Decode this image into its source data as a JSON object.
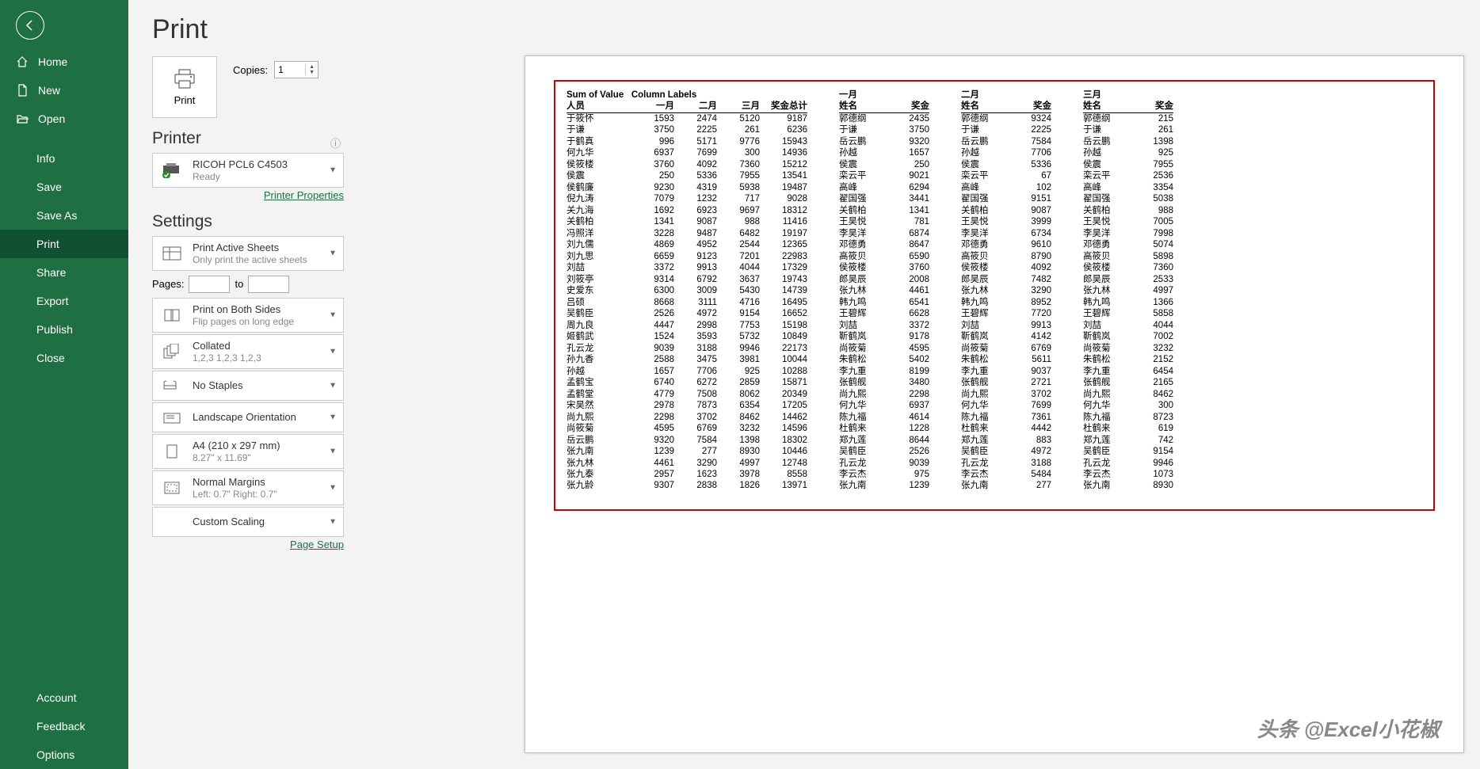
{
  "sidebar": {
    "back": "←",
    "items": [
      {
        "icon": "home",
        "label": "Home"
      },
      {
        "icon": "new",
        "label": "New"
      },
      {
        "icon": "open",
        "label": "Open"
      }
    ],
    "subitems": [
      "Info",
      "Save",
      "Save As",
      "Print",
      "Share",
      "Export",
      "Publish",
      "Close"
    ],
    "active": "Print",
    "footer": [
      "Account",
      "Feedback",
      "Options"
    ]
  },
  "page": {
    "title": "Print",
    "print_btn": "Print",
    "copies_label": "Copies:",
    "copies_value": "1",
    "printer_head": "Printer",
    "printer_name": "RICOH PCL6 C4503",
    "printer_status": "Ready",
    "printer_props": "Printer Properties",
    "settings_head": "Settings",
    "pages_label": "Pages:",
    "pages_to": "to",
    "page_setup": "Page Setup",
    "combos": [
      {
        "l1": "Print Active Sheets",
        "l2": "Only print the active sheets"
      },
      {
        "l1": "Print on Both Sides",
        "l2": "Flip pages on long edge"
      },
      {
        "l1": "Collated",
        "l2": "1,2,3    1,2,3    1,2,3"
      },
      {
        "l1": "No Staples",
        "l2": ""
      },
      {
        "l1": "Landscape Orientation",
        "l2": ""
      },
      {
        "l1": "A4 (210 x 297 mm)",
        "l2": "8.27\" x 11.69\""
      },
      {
        "l1": "Normal Margins",
        "l2": "Left: 0.7\"   Right: 0.7\""
      },
      {
        "l1": "Custom Scaling",
        "l2": ""
      }
    ]
  },
  "preview": {
    "watermark": "头条 @Excel小花椒",
    "pivot_label1": "Sum of Value",
    "pivot_label2": "Column Labels",
    "row_header": "人员",
    "col_headers": [
      "一月",
      "二月",
      "三月",
      "奖金总计"
    ],
    "rows": [
      [
        "于筱怀",
        "1593",
        "2474",
        "5120",
        "9187"
      ],
      [
        "于谦",
        "3750",
        "2225",
        "261",
        "6236"
      ],
      [
        "于鹤真",
        "996",
        "5171",
        "9776",
        "15943"
      ],
      [
        "何九华",
        "6937",
        "7699",
        "300",
        "14936"
      ],
      [
        "侯筱楼",
        "3760",
        "4092",
        "7360",
        "15212"
      ],
      [
        "侯震",
        "250",
        "5336",
        "7955",
        "13541"
      ],
      [
        "侯鹤廉",
        "9230",
        "4319",
        "5938",
        "19487"
      ],
      [
        "倪九涛",
        "7079",
        "1232",
        "717",
        "9028"
      ],
      [
        "关九海",
        "1692",
        "6923",
        "9697",
        "18312"
      ],
      [
        "关鹤柏",
        "1341",
        "9087",
        "988",
        "11416"
      ],
      [
        "冯照洋",
        "3228",
        "9487",
        "6482",
        "19197"
      ],
      [
        "刘九儒",
        "4869",
        "4952",
        "2544",
        "12365"
      ],
      [
        "刘九思",
        "6659",
        "9123",
        "7201",
        "22983"
      ],
      [
        "刘喆",
        "3372",
        "9913",
        "4044",
        "17329"
      ],
      [
        "刘筱亭",
        "9314",
        "6792",
        "3637",
        "19743"
      ],
      [
        "史爱东",
        "6300",
        "3009",
        "5430",
        "14739"
      ],
      [
        "吕硕",
        "8668",
        "3111",
        "4716",
        "16495"
      ],
      [
        "吴鹤臣",
        "2526",
        "4972",
        "9154",
        "16652"
      ],
      [
        "周九良",
        "4447",
        "2998",
        "7753",
        "15198"
      ],
      [
        "姬鹤武",
        "1524",
        "3593",
        "5732",
        "10849"
      ],
      [
        "孔云龙",
        "9039",
        "3188",
        "9946",
        "22173"
      ],
      [
        "孙九香",
        "2588",
        "3475",
        "3981",
        "10044"
      ],
      [
        "孙越",
        "1657",
        "7706",
        "925",
        "10288"
      ],
      [
        "孟鹤宝",
        "6740",
        "6272",
        "2859",
        "15871"
      ],
      [
        "孟鹤堂",
        "4779",
        "7508",
        "8062",
        "20349"
      ],
      [
        "宋昊然",
        "2978",
        "7873",
        "6354",
        "17205"
      ],
      [
        "尚九熙",
        "2298",
        "3702",
        "8462",
        "14462"
      ],
      [
        "尚筱菊",
        "4595",
        "6769",
        "3232",
        "14596"
      ],
      [
        "岳云鹏",
        "9320",
        "7584",
        "1398",
        "18302"
      ],
      [
        "张九南",
        "1239",
        "277",
        "8930",
        "10446"
      ],
      [
        "张九林",
        "4461",
        "3290",
        "4997",
        "12748"
      ],
      [
        "张九泰",
        "2957",
        "1623",
        "3978",
        "8558"
      ],
      [
        "张九龄",
        "9307",
        "2838",
        "1826",
        "13971"
      ]
    ],
    "months": [
      {
        "title": "一月",
        "name_h": "姓名",
        "val_h": "奖金",
        "rows": [
          [
            "郭德纲",
            "2435"
          ],
          [
            "于谦",
            "3750"
          ],
          [
            "岳云鹏",
            "9320"
          ],
          [
            "孙越",
            "1657"
          ],
          [
            "侯震",
            "250"
          ],
          [
            "栾云平",
            "9021"
          ],
          [
            "高峰",
            "6294"
          ],
          [
            "翟国强",
            "3441"
          ],
          [
            "关鹤柏",
            "1341"
          ],
          [
            "王昊悦",
            "781"
          ],
          [
            "李昊洋",
            "6874"
          ],
          [
            "邓德勇",
            "8647"
          ],
          [
            "高筱贝",
            "6590"
          ],
          [
            "侯筱楼",
            "3760"
          ],
          [
            "郎昊辰",
            "2008"
          ],
          [
            "张九林",
            "4461"
          ],
          [
            "韩九鸣",
            "6541"
          ],
          [
            "王碧辉",
            "6628"
          ],
          [
            "刘喆",
            "3372"
          ],
          [
            "靳鹤岚",
            "9178"
          ],
          [
            "尚筱菊",
            "4595"
          ],
          [
            "朱鹤松",
            "5402"
          ],
          [
            "李九重",
            "8199"
          ],
          [
            "张鹤舰",
            "3480"
          ],
          [
            "尚九熙",
            "2298"
          ],
          [
            "何九华",
            "6937"
          ],
          [
            "陈九福",
            "4614"
          ],
          [
            "杜鹤来",
            "1228"
          ],
          [
            "郑九莲",
            "8644"
          ],
          [
            "吴鹤臣",
            "2526"
          ],
          [
            "孔云龙",
            "9039"
          ],
          [
            "李云杰",
            "975"
          ],
          [
            "张九南",
            "1239"
          ]
        ]
      },
      {
        "title": "二月",
        "name_h": "姓名",
        "val_h": "奖金",
        "rows": [
          [
            "郭德纲",
            "9324"
          ],
          [
            "于谦",
            "2225"
          ],
          [
            "岳云鹏",
            "7584"
          ],
          [
            "孙越",
            "7706"
          ],
          [
            "侯震",
            "5336"
          ],
          [
            "栾云平",
            "67"
          ],
          [
            "高峰",
            "102"
          ],
          [
            "翟国强",
            "9151"
          ],
          [
            "关鹤柏",
            "9087"
          ],
          [
            "王昊悦",
            "3999"
          ],
          [
            "李昊洋",
            "6734"
          ],
          [
            "邓德勇",
            "9610"
          ],
          [
            "高筱贝",
            "8790"
          ],
          [
            "侯筱楼",
            "4092"
          ],
          [
            "郎昊辰",
            "7482"
          ],
          [
            "张九林",
            "3290"
          ],
          [
            "韩九鸣",
            "8952"
          ],
          [
            "王碧辉",
            "7720"
          ],
          [
            "刘喆",
            "9913"
          ],
          [
            "靳鹤岚",
            "4142"
          ],
          [
            "尚筱菊",
            "6769"
          ],
          [
            "朱鹤松",
            "5611"
          ],
          [
            "李九重",
            "9037"
          ],
          [
            "张鹤舰",
            "2721"
          ],
          [
            "尚九熙",
            "3702"
          ],
          [
            "何九华",
            "7699"
          ],
          [
            "陈九福",
            "7361"
          ],
          [
            "杜鹤来",
            "4442"
          ],
          [
            "郑九莲",
            "883"
          ],
          [
            "吴鹤臣",
            "4972"
          ],
          [
            "孔云龙",
            "3188"
          ],
          [
            "李云杰",
            "5484"
          ],
          [
            "张九南",
            "277"
          ]
        ]
      },
      {
        "title": "三月",
        "name_h": "姓名",
        "val_h": "奖金",
        "rows": [
          [
            "郭德纲",
            "215"
          ],
          [
            "于谦",
            "261"
          ],
          [
            "岳云鹏",
            "1398"
          ],
          [
            "孙越",
            "925"
          ],
          [
            "侯震",
            "7955"
          ],
          [
            "栾云平",
            "2536"
          ],
          [
            "高峰",
            "3354"
          ],
          [
            "翟国强",
            "5038"
          ],
          [
            "关鹤柏",
            "988"
          ],
          [
            "王昊悦",
            "7005"
          ],
          [
            "李昊洋",
            "7998"
          ],
          [
            "邓德勇",
            "5074"
          ],
          [
            "高筱贝",
            "5898"
          ],
          [
            "侯筱楼",
            "7360"
          ],
          [
            "郎昊辰",
            "2533"
          ],
          [
            "张九林",
            "4997"
          ],
          [
            "韩九鸣",
            "1366"
          ],
          [
            "王碧辉",
            "5858"
          ],
          [
            "刘喆",
            "4044"
          ],
          [
            "靳鹤岚",
            "7002"
          ],
          [
            "尚筱菊",
            "3232"
          ],
          [
            "朱鹤松",
            "2152"
          ],
          [
            "李九重",
            "6454"
          ],
          [
            "张鹤舰",
            "2165"
          ],
          [
            "尚九熙",
            "8462"
          ],
          [
            "何九华",
            "300"
          ],
          [
            "陈九福",
            "8723"
          ],
          [
            "杜鹤来",
            "619"
          ],
          [
            "郑九莲",
            "742"
          ],
          [
            "吴鹤臣",
            "9154"
          ],
          [
            "孔云龙",
            "9946"
          ],
          [
            "李云杰",
            "1073"
          ],
          [
            "张九南",
            "8930"
          ]
        ]
      }
    ]
  }
}
